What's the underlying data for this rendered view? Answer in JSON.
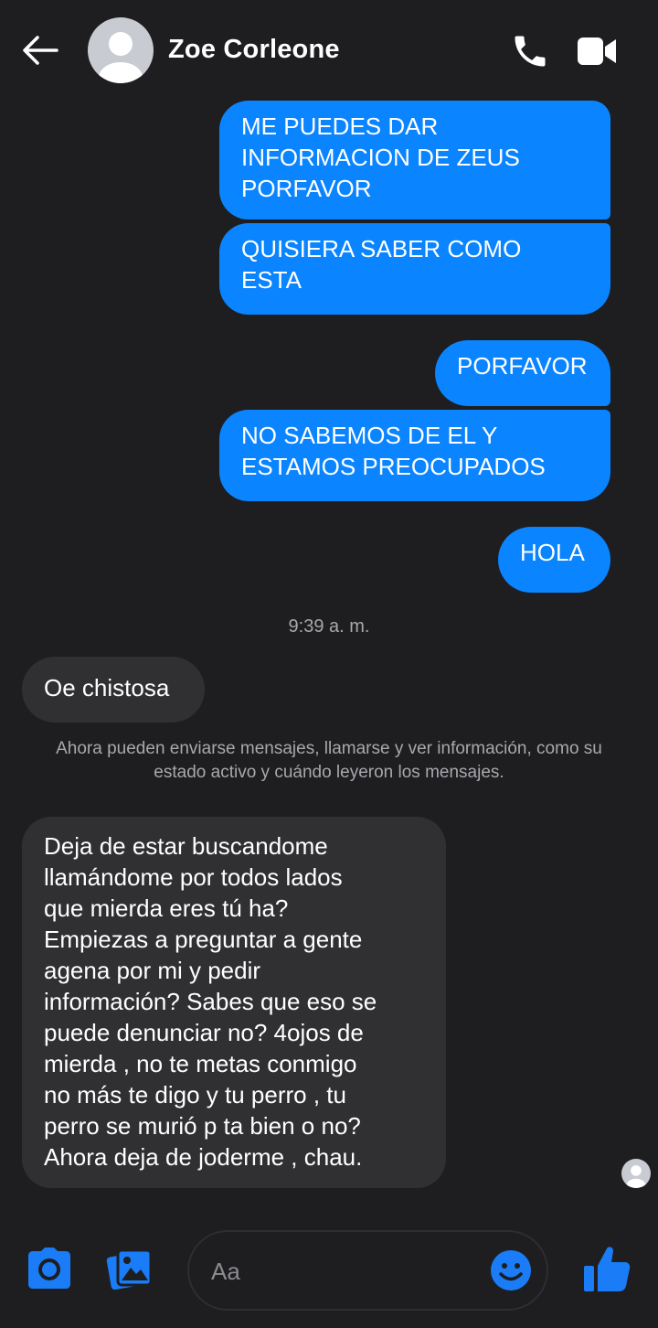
{
  "header": {
    "contact_name": "Zoe Corleone",
    "back_icon": "arrow-left-icon",
    "call_icon": "phone-icon",
    "video_icon": "video-camera-icon"
  },
  "messages": {
    "out_1": "ME PUEDES DAR\nINFORMACION DE ZEUS\nPORFAVOR",
    "out_2": "QUISIERA SABER COMO\nESTA",
    "out_3": "PORFAVOR",
    "out_4": "NO SABEMOS DE EL Y\nESTAMOS PREOCUPADOS",
    "out_5": "HOLA",
    "timestamp": "9:39 a. m.",
    "in_1": "Oe chistosa",
    "notice": "Ahora pueden enviarse mensajes, llamarse y ver información, como su estado activo y cuándo leyeron los mensajes.",
    "in_2": "Deja de estar buscandome\nllamándome por todos lados\nque mierda eres tú ha?\nEmpiezas a preguntar a gente\nagena por mi y pedir\ninformación? Sabes que eso se\npuede denunciar no? 4ojos de\nmierda , no te metas conmigo\nno más te digo y tu perro , tu\nperro se murió p ta bien o no?\nAhora deja de joderme , chau."
  },
  "composer": {
    "placeholder": "Aa",
    "value": "",
    "camera_icon": "camera-icon",
    "gallery_icon": "gallery-icon",
    "emoji_icon": "emoji-icon",
    "like_icon": "thumbs-up-icon"
  },
  "colors": {
    "background": "#1e1e20",
    "outgoing_bubble": "#0a84ff",
    "incoming_bubble": "#303033",
    "accent": "#0a84ff"
  }
}
